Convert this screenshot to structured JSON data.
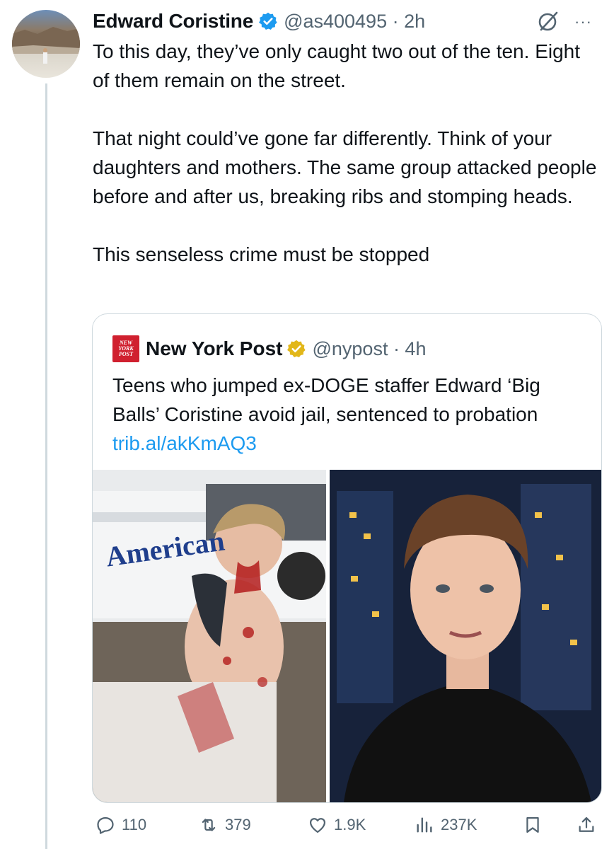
{
  "post": {
    "author_name": "Edward Coristine",
    "handle_time": "@as400495 · 2h",
    "paragraphs": [
      "To this day, they’ve only caught two out of the ten. Eight of them remain on the street.",
      "That night could’ve gone far differently. Think of your daughters and mothers. The same group attacked people before and after us, breaking ribs and stomping heads.",
      "This senseless crime must be stopped"
    ],
    "more_label": "···"
  },
  "quote": {
    "logo_lines": [
      "NEW",
      "YORK",
      "POST"
    ],
    "author_name": "New York Post",
    "handle_time": "@nypost · 4h",
    "text": "Teens who jumped ex-DOGE staffer Edward ‘Big Balls’ Coristine avoid jail, sentenced to probation ",
    "link": "trib.al/akKmAQ3",
    "left_image_sign": "American"
  },
  "actions": {
    "replies": "110",
    "reposts": "379",
    "likes": "1.9K",
    "views": "237K"
  },
  "colors": {
    "verified_blue": "#1d9bf0",
    "verified_gold": "#e2b719",
    "link": "#1d9bf0",
    "secondary": "#536471",
    "nypost_red": "#d0202f"
  },
  "icons": {
    "reply": "reply-icon",
    "repost": "repost-icon",
    "like": "heart-icon",
    "views": "views-icon",
    "bookmark": "bookmark-icon",
    "share": "share-icon",
    "grok": "grok-icon"
  }
}
